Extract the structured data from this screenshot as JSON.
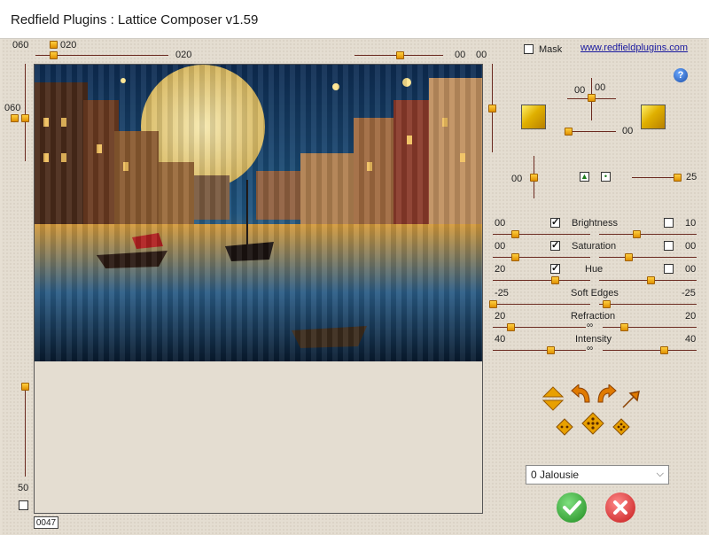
{
  "window": {
    "title": "Redfield Plugins : Lattice Composer v1.59"
  },
  "top": {
    "left_label": "060",
    "small_slider_value": "020",
    "wide_slider_value": "020",
    "right_slider_value_a": "00",
    "right_slider_value_b": "00",
    "left_vertical_value": "060",
    "bottom_vertical_value": "50",
    "counter": "0047"
  },
  "options": {
    "mask_label": "Mask",
    "website": "www.redfieldplugins.com",
    "help_symbol": "?"
  },
  "offset": {
    "x_value": "00",
    "y_value": "00",
    "h_slider_value": "00"
  },
  "zoom": {
    "left_value": "00",
    "right_value": "25"
  },
  "adjustments": [
    {
      "label": "Brightness",
      "left_value": "00",
      "right_value": "10",
      "left_checked": true,
      "right_checked": false
    },
    {
      "label": "Saturation",
      "left_value": "00",
      "right_value": "00",
      "left_checked": true,
      "right_checked": false
    },
    {
      "label": "Hue",
      "left_value": "20",
      "right_value": "00",
      "left_checked": true,
      "right_checked": false
    },
    {
      "label": "Soft Edges",
      "left_value": "-25",
      "right_value": "-25"
    },
    {
      "label": "Refraction",
      "left_value": "20",
      "right_value": "20"
    },
    {
      "label": "Intensity",
      "left_value": "40",
      "right_value": "40"
    }
  ],
  "preset": {
    "selected": "0 Jalousie"
  },
  "colors": {
    "accent": "#e8a000",
    "track": "#6b2a20",
    "ok": "#2f9e2f",
    "cancel": "#d42a2a"
  }
}
